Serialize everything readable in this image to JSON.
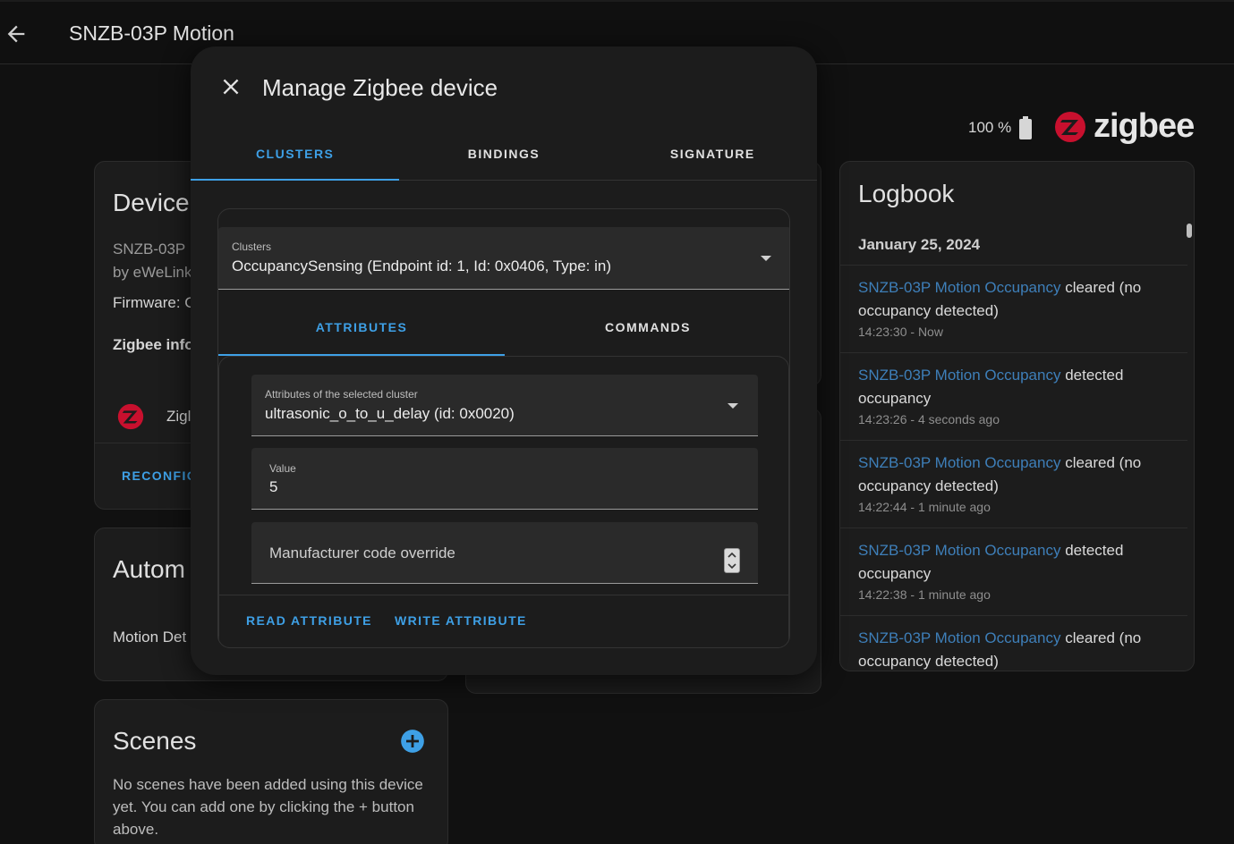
{
  "header": {
    "title": "SNZB-03P Motion"
  },
  "device_info": {
    "title": "Device",
    "model": "SNZB-03P",
    "manufacturer": "by eWeLink",
    "firmware_label": "Firmware: C",
    "zigbee_info": "Zigbee info",
    "zigbee_row": "Zigl",
    "reconfigure": "RECONFIC"
  },
  "automations": {
    "title": "Autom",
    "item": "Motion Det"
  },
  "scenes": {
    "title": "Scenes",
    "text": "No scenes have been added using this device yet. You can add one by clicking the + button above."
  },
  "status": {
    "battery": "100 %",
    "brand": "zigbee"
  },
  "logbook": {
    "title": "Logbook",
    "date": "January 25, 2024",
    "entries": [
      {
        "entity": "SNZB-03P Motion Occupancy",
        "state_a": " cleared (no",
        "state_b": "occupancy detected)",
        "time": "14:23:30 - Now"
      },
      {
        "entity": "SNZB-03P Motion Occupancy",
        "state_a": " detected",
        "state_b": "occupancy",
        "time": "14:23:26 - 4 seconds ago"
      },
      {
        "entity": "SNZB-03P Motion Occupancy",
        "state_a": " cleared (no",
        "state_b": "occupancy detected)",
        "time": "14:22:44 - 1 minute ago"
      },
      {
        "entity": "SNZB-03P Motion Occupancy",
        "state_a": " detected",
        "state_b": "occupancy",
        "time": "14:22:38 - 1 minute ago"
      },
      {
        "entity": "SNZB-03P Motion Occupancy",
        "state_a": " cleared (no",
        "state_b": "occupancy detected)",
        "time": ""
      }
    ]
  },
  "modal": {
    "title": "Manage Zigbee device",
    "tabs": [
      "CLUSTERS",
      "BINDINGS",
      "SIGNATURE"
    ],
    "cluster_select": {
      "label": "Clusters",
      "value": "OccupancySensing (Endpoint id: 1, Id: 0x0406, Type: in)"
    },
    "subtabs": [
      "ATTRIBUTES",
      "COMMANDS"
    ],
    "attribute_select": {
      "label": "Attributes of the selected cluster",
      "value": "ultrasonic_o_to_u_delay (id: 0x0020)"
    },
    "value_field": {
      "label": "Value",
      "value": "5"
    },
    "manufacturer_field": {
      "placeholder": "Manufacturer code override"
    },
    "actions": {
      "read": "READ ATTRIBUTE",
      "write": "WRITE ATTRIBUTE"
    }
  },
  "colors": {
    "accent": "#3ea0e6",
    "link": "#3e7fb9",
    "zigbee_red": "#c8102e"
  }
}
